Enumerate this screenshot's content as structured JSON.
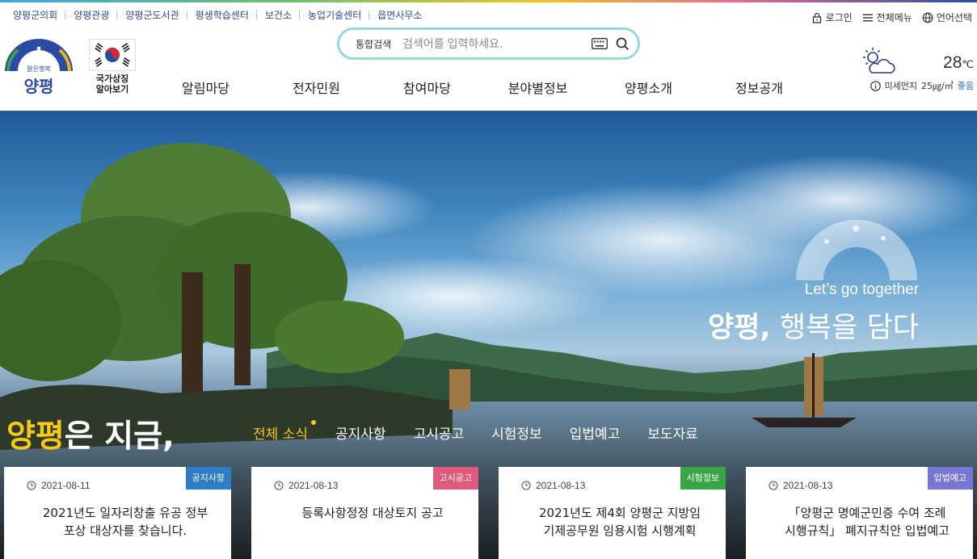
{
  "utility_links": [
    "양평군의회",
    "양평관광",
    "양평군도서관",
    "평생학습센터",
    "보건소",
    "농업기술센터",
    "읍면사무소"
  ],
  "utility_right": {
    "login": "로그인",
    "all_menu": "전체메뉴",
    "language": "언어선택"
  },
  "logo": {
    "tagline": "맑은행복",
    "name": "양평"
  },
  "national_symbol": {
    "line1": "국가상징",
    "line2": "알아보기"
  },
  "search": {
    "category": "통합검색",
    "placeholder": "검색어를 입력하세요."
  },
  "nav": [
    "알림마당",
    "전자민원",
    "참여마당",
    "분야별정보",
    "양평소개",
    "정보공개"
  ],
  "weather": {
    "temp": "28",
    "unit": "℃",
    "dust_label": "미세먼지",
    "dust_value": "25㎍/㎥",
    "dust_status": "좋음"
  },
  "hero": {
    "slogan_en": "Let’s go together",
    "slogan_bold": "양평,",
    "slogan_rest": " 행복을 담다"
  },
  "now": {
    "highlight": "양평",
    "rest": "은 지금,",
    "tabs": [
      "전체 소식",
      "공지사항",
      "고시공고",
      "시험정보",
      "입법예고",
      "보도자료"
    ],
    "active_tab": "전체 소식"
  },
  "cards": [
    {
      "date": "2021-08-11",
      "badge": "공지사항",
      "badge_color": "#2f7dc4",
      "line1": "2021년도 일자리창출 유공 정부",
      "line2": "포상 대상자를 찾습니다."
    },
    {
      "date": "2021-08-13",
      "badge": "고시공고",
      "badge_color": "#e05a7b",
      "line1": "등록사항정정 대상토지 공고",
      "line2": ""
    },
    {
      "date": "2021-08-13",
      "badge": "시험정보",
      "badge_color": "#3aa545",
      "line1": "2021년도 제4회 양평군 지방임",
      "line2": "기제공무원 임용시험 시행계획"
    },
    {
      "date": "2021-08-13",
      "badge": "입법예고",
      "badge_color": "#7776d4",
      "line1": "「양평군 명예군민증 수여 조례",
      "line2": "시행규칙」 폐지규칙안 입법예고"
    }
  ]
}
